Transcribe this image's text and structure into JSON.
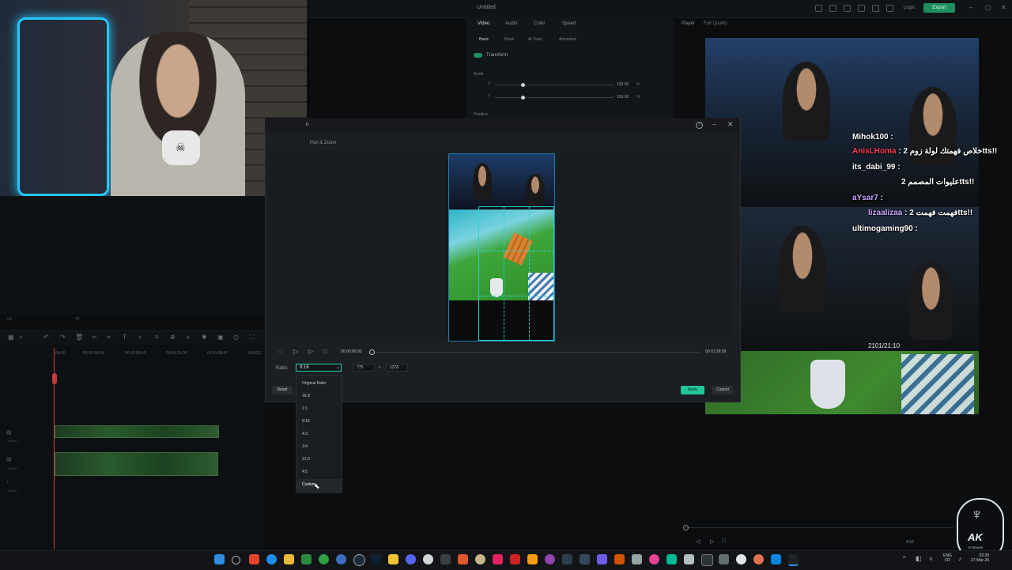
{
  "app": {
    "title": "Untitled",
    "login": "Login",
    "export": "Export"
  },
  "inspector": {
    "tabs": [
      "Video",
      "Audio",
      "Color",
      "Speed"
    ],
    "subtabs": [
      "Basic",
      "Mask",
      "AI Tools",
      "Animation"
    ],
    "transform": "Transform",
    "scale": "Scale",
    "scale_x_label": "X",
    "scale_y_label": "Y",
    "scale_x": "100.00",
    "scale_y": "100.00",
    "unit": "%",
    "position": "Position"
  },
  "player": {
    "label": "Player",
    "quality": "Full Quality"
  },
  "timeline": {
    "ruler": [
      "00:00",
      "00:00:29:05",
      "00:00:59:53",
      "00:01:29:00",
      "00:01:58:47",
      "00:02:2"
    ],
    "tracks": [
      "Video 2",
      "Video 1",
      "Audio 1"
    ]
  },
  "dialog": {
    "title_fragment": "n",
    "section": "Pan & Zoom",
    "time_current": "00:00:00:00",
    "time_total": "00:01:39:59",
    "ratio_label": "Ratio:",
    "ratio_value": "9:16",
    "width": "775",
    "x_sep": "x",
    "height": "1378",
    "reset": "Reset",
    "apply": "Apply",
    "cancel": "Cancel",
    "ratio_options": [
      "Original Ratio",
      "16:9",
      "1:1",
      "9:16",
      "4:3",
      "3:4",
      "21:9",
      "4:5",
      "Custom"
    ]
  },
  "stream_chat": [
    {
      "user": "Mihok100",
      "msg": ""
    },
    {
      "user": "AnisLHoma",
      "msg": "خلاص فهمتك لولة زوم 2tts!!"
    },
    {
      "user": "its_dabi_99",
      "msg": ""
    },
    {
      "user": "",
      "msg": "عليوات المصمم 2tts!!"
    },
    {
      "user": "aYsar7",
      "msg": ""
    },
    {
      "user": "lizaalizaa",
      "msg": "فهمت فهمت 2tts!!"
    },
    {
      "user": "ultimogaming90",
      "msg": ""
    }
  ],
  "stream_overlay": {
    "count": "2101/21:10"
  },
  "player_time": "9:16",
  "logo": {
    "text": "AK",
    "sub": "STREAMS"
  },
  "tray": {
    "lang1": "ENG",
    "lang2": "FR",
    "time": "02:28",
    "date": "27-Mar-26"
  },
  "colors": {
    "accent": "#22c69b",
    "crop": "#29d3c8",
    "playhead": "#c73a3a"
  }
}
